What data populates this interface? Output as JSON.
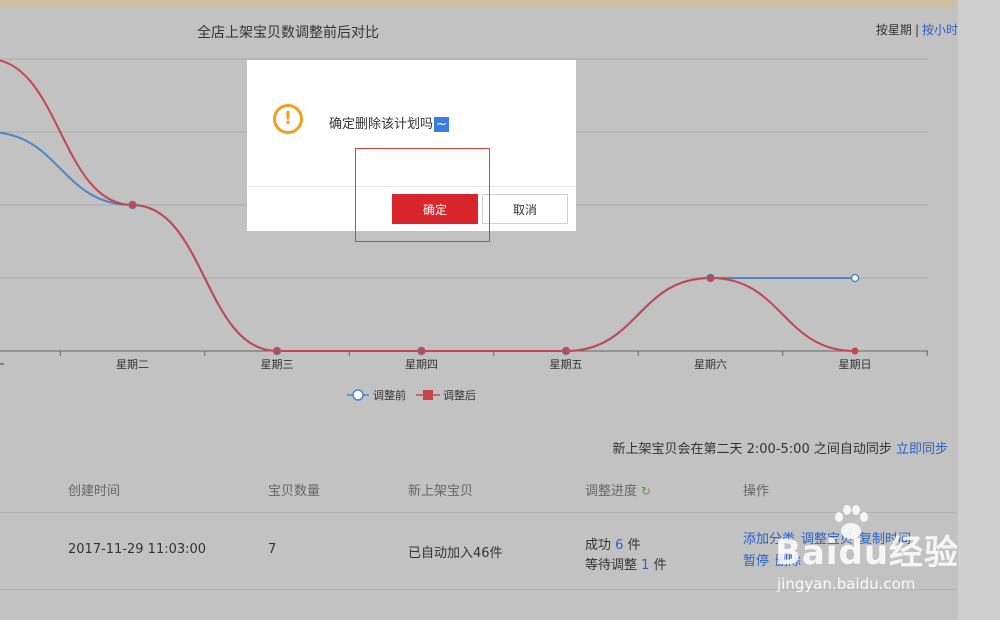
{
  "chart_title": "全店上架宝贝数调整前后对比",
  "view_toggle": {
    "by_week": "按星期",
    "separator": "|",
    "by_hour": "按小时"
  },
  "chart_data": {
    "type": "line",
    "categories": [
      "星期一",
      "星期二",
      "星期三",
      "星期四",
      "星期五",
      "星期六",
      "星期日"
    ],
    "series": [
      {
        "name": "调整前",
        "color": "#4a86c8",
        "values": [
          3,
          2,
          0,
          0,
          0,
          1,
          1
        ]
      },
      {
        "name": "调整后",
        "color": "#c8464b",
        "values": [
          4,
          2,
          0,
          0,
          0,
          1,
          0
        ]
      }
    ],
    "ylim": [
      0,
      4
    ],
    "grid": true,
    "legend": "bottom-center"
  },
  "sync_notice": {
    "text": "新上架宝贝会在第二天 2:00-5:00 之间自动同步",
    "link": "立即同步"
  },
  "table": {
    "headers": {
      "created": "创建时间",
      "count": "宝贝数量",
      "new_items": "新上架宝贝",
      "progress": "调整进度",
      "ops": "操作"
    },
    "row": {
      "created": "2017-11-29 11:03:00",
      "count": "7",
      "new_items": "已自动加入46件",
      "success_pre": "成功",
      "success_num": "6",
      "success_unit": "件",
      "waiting_pre": "等待调整",
      "waiting_num": "1",
      "waiting_unit": "件",
      "ops_line1": [
        "添加分类",
        "调整宝贝",
        "复制时间"
      ],
      "ops_line2": [
        "暂停",
        "删除"
      ]
    }
  },
  "dialog": {
    "message": "确定删除该计划吗",
    "tilde": "~",
    "confirm": "确定",
    "cancel": "取消",
    "warn_icon": "!"
  },
  "watermark": {
    "logo": "Baidu经验",
    "url": "jingyan.baidu.com"
  }
}
